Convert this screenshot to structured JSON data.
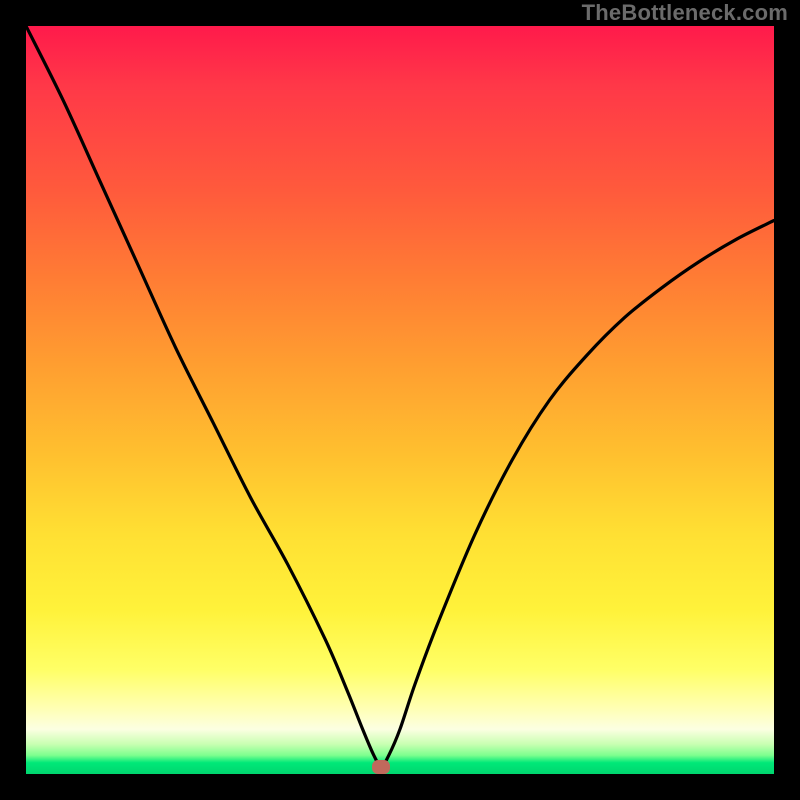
{
  "watermark": "TheBottleneck.com",
  "colors": {
    "frame_bg": "#000000",
    "curve_stroke": "#000000",
    "marker_fill": "#c0695c",
    "gradient_top": "#ff1a4b",
    "gradient_bottom": "#00d66f"
  },
  "chart_data": {
    "type": "line",
    "title": "",
    "xlabel": "",
    "ylabel": "",
    "xlim": [
      0,
      100
    ],
    "ylim": [
      0,
      100
    ],
    "notes": "V-shaped bottleneck curve over red-to-green vertical heat gradient. Minimum near x≈47.5. Left branch starts at top-left, right branch rises to ~74 at x=100.",
    "marker": {
      "x": 47.5,
      "y": 1.0
    },
    "series": [
      {
        "name": "bottleneck-curve",
        "x": [
          0,
          5,
          10,
          15,
          20,
          25,
          30,
          35,
          40,
          43,
          45,
          46.5,
          47.5,
          48.5,
          50,
          52,
          55,
          60,
          65,
          70,
          75,
          80,
          85,
          90,
          95,
          100
        ],
        "values": [
          100,
          90,
          79,
          68,
          57,
          47,
          37,
          28,
          18,
          11,
          6,
          2.5,
          1.0,
          2.5,
          6,
          12,
          20,
          32,
          42,
          50,
          56,
          61,
          65,
          68.5,
          71.5,
          74
        ]
      }
    ]
  }
}
